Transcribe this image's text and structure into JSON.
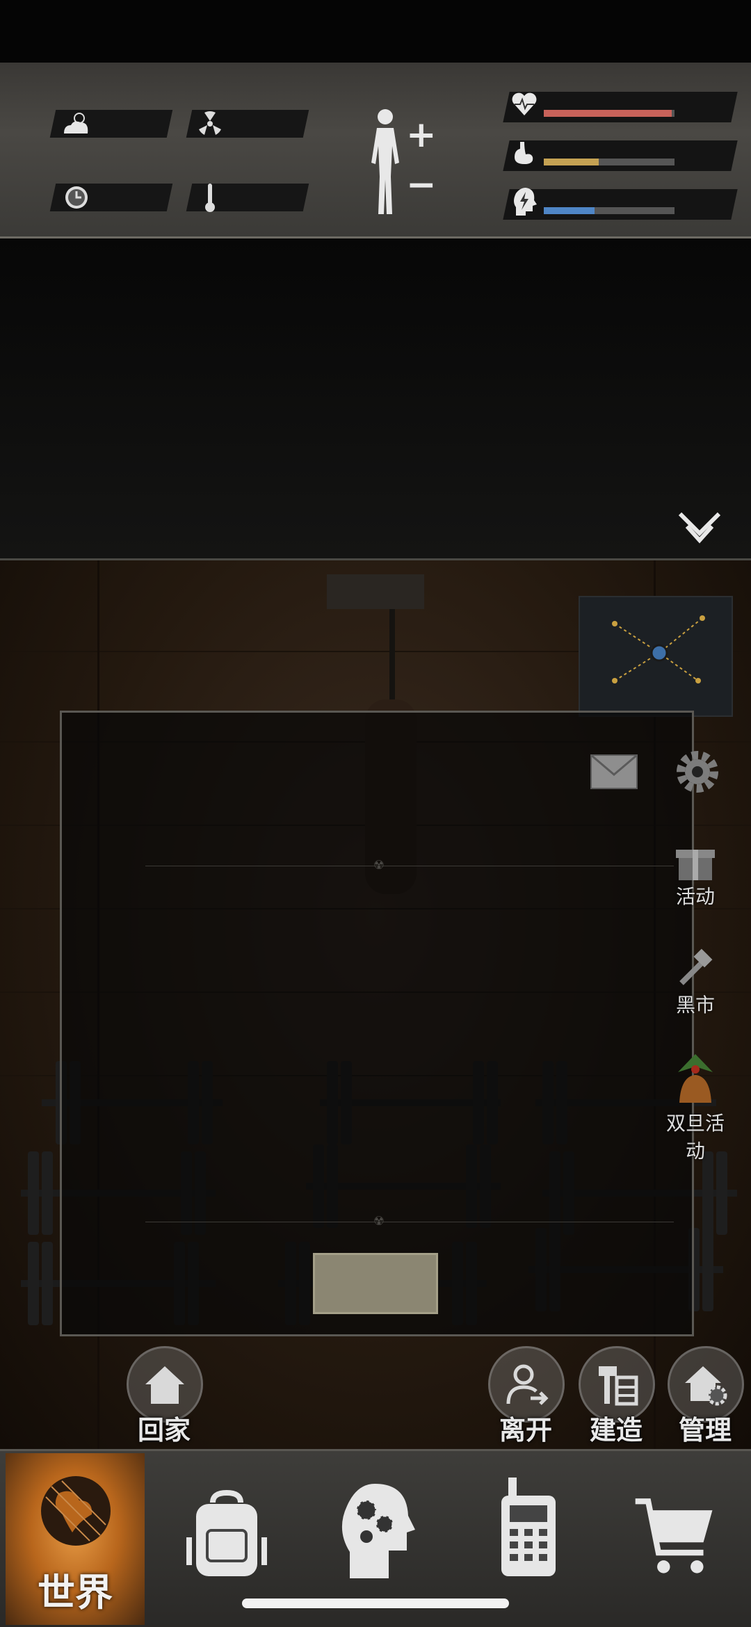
{
  "hud": {
    "weather_icon": "cloud-sun-icon",
    "radiation_icon": "radiation-icon",
    "time_icon": "clock-icon",
    "temperature_icon": "thermometer-icon",
    "body_add": "+",
    "body_remove": "−",
    "stats": [
      {
        "name": "health",
        "icon": "heart-pulse-icon",
        "value": 0.98,
        "color": "#c8625a"
      },
      {
        "name": "hunger",
        "icon": "stomach-icon",
        "value": 0.42,
        "color": "#c5a253"
      },
      {
        "name": "energy",
        "icon": "head-bolt-icon",
        "value": 0.39,
        "color": "#4f86c6"
      }
    ]
  },
  "log": {
    "collapse_icon": "double-chevron-down-icon"
  },
  "side_menu": {
    "mail_icon": "mail-icon",
    "settings_icon": "gear-icon",
    "events_label": "活动",
    "black_market_label": "黑市",
    "double_eleven_label": "双旦活动"
  },
  "actions": {
    "home_label": "回家",
    "leave_label": "离开",
    "build_label": "建造",
    "manage_label": "管理"
  },
  "nav": {
    "world_label": "世界",
    "items": [
      "world",
      "backpack",
      "skills",
      "radio",
      "shop"
    ]
  }
}
